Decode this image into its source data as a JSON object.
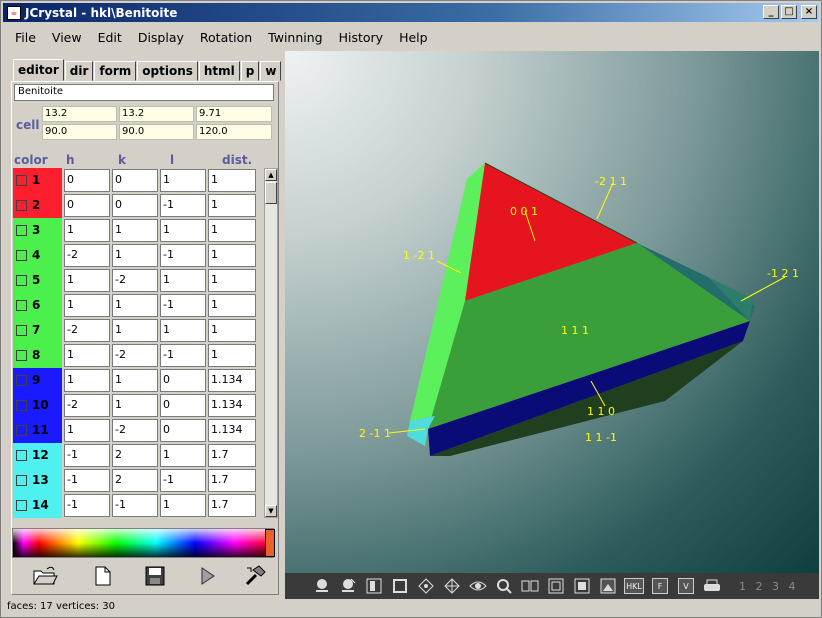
{
  "window": {
    "title": "JCrystal - hkl\\Benitoite",
    "min_label": "_",
    "max_label": "□",
    "close_label": "×"
  },
  "menu": [
    {
      "label": "File"
    },
    {
      "label": "View"
    },
    {
      "label": "Edit"
    },
    {
      "label": "Display"
    },
    {
      "label": "Rotation"
    },
    {
      "label": "Twinning"
    },
    {
      "label": "History"
    },
    {
      "label": "Help"
    }
  ],
  "tabs": [
    {
      "label": "editor",
      "active": true
    },
    {
      "label": "dir"
    },
    {
      "label": "form"
    },
    {
      "label": "options"
    },
    {
      "label": "html"
    },
    {
      "label": "p"
    },
    {
      "label": "w"
    }
  ],
  "editor": {
    "name": "Benitoite",
    "cell_label": "cell",
    "cell": {
      "a": "13.2",
      "b": "13.2",
      "c": "9.71",
      "alpha": "90.0",
      "beta": "90.0",
      "gamma": "120.0"
    },
    "columns": {
      "color": "color",
      "h": "h",
      "k": "k",
      "l": "l",
      "dist": "dist."
    },
    "rows": [
      {
        "n": "1",
        "h": "0",
        "k": "0",
        "l": "1",
        "dist": "1",
        "color": "#ff1e2e"
      },
      {
        "n": "2",
        "h": "0",
        "k": "0",
        "l": "-1",
        "dist": "1",
        "color": "#ff1e2e"
      },
      {
        "n": "3",
        "h": "1",
        "k": "1",
        "l": "1",
        "dist": "1",
        "color": "#4cf04c"
      },
      {
        "n": "4",
        "h": "-2",
        "k": "1",
        "l": "-1",
        "dist": "1",
        "color": "#4cf04c"
      },
      {
        "n": "5",
        "h": "1",
        "k": "-2",
        "l": "1",
        "dist": "1",
        "color": "#4cf04c"
      },
      {
        "n": "6",
        "h": "1",
        "k": "1",
        "l": "-1",
        "dist": "1",
        "color": "#4cf04c"
      },
      {
        "n": "7",
        "h": "-2",
        "k": "1",
        "l": "1",
        "dist": "1",
        "color": "#4cf04c"
      },
      {
        "n": "8",
        "h": "1",
        "k": "-2",
        "l": "-1",
        "dist": "1",
        "color": "#4cf04c"
      },
      {
        "n": "9",
        "h": "1",
        "k": "1",
        "l": "0",
        "dist": "1.134",
        "color": "#1a1aff"
      },
      {
        "n": "10",
        "h": "-2",
        "k": "1",
        "l": "0",
        "dist": "1.134",
        "color": "#1a1aff"
      },
      {
        "n": "11",
        "h": "1",
        "k": "-2",
        "l": "0",
        "dist": "1.134",
        "color": "#1a1aff"
      },
      {
        "n": "12",
        "h": "-1",
        "k": "2",
        "l": "1",
        "dist": "1.7",
        "color": "#4ef0f0"
      },
      {
        "n": "13",
        "h": "-1",
        "k": "2",
        "l": "-1",
        "dist": "1.7",
        "color": "#4ef0f0"
      },
      {
        "n": "14",
        "h": "-1",
        "k": "-1",
        "l": "1",
        "dist": "1.7",
        "color": "#4ef0f0"
      }
    ]
  },
  "left_toolbar": [
    {
      "icon": "open-folder-icon"
    },
    {
      "icon": "new-file-icon"
    },
    {
      "icon": "save-icon"
    },
    {
      "icon": "play-icon"
    },
    {
      "icon": "hammer-icon"
    }
  ],
  "crystal_labels": [
    {
      "text": "0 0 1"
    },
    {
      "text": "-2 1 1"
    },
    {
      "text": "1 -2 1"
    },
    {
      "text": "-1 2 1"
    },
    {
      "text": "1 1 1"
    },
    {
      "text": "1 1 0"
    },
    {
      "text": "1 1 -1"
    },
    {
      "text": "2 -1 1"
    }
  ],
  "viewer_toolbar": {
    "icons": [
      "rotate-view-icon",
      "rotate-alt-icon",
      "frame-icon",
      "square-icon",
      "axis-icon",
      "axis-alt-icon",
      "eye-icon",
      "zoom-icon",
      "stereo-icon",
      "outline-icon",
      "box-icon",
      "image-icon",
      "hkl-icon",
      "f-icon",
      "v-icon",
      "print-icon"
    ],
    "hkl_label": "HKL",
    "f_label": "F",
    "v_label": "V",
    "pages": "1 2 3 4"
  },
  "status": "faces: 17  vertices: 30"
}
